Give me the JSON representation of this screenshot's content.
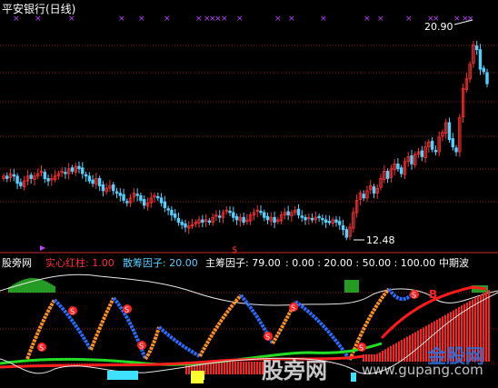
{
  "window": {
    "title": "平安银行(日线)"
  },
  "price_chart": {
    "high_label": "20.90",
    "low_label": "12.48",
    "gridline_color": "#8b1a1a",
    "up_color": "#ff3030",
    "down_color": "#54d0ff",
    "marker_color": "#c040ff"
  },
  "indicator_bar": {
    "source": "股旁网",
    "items": [
      {
        "label": "实心红柱",
        "value": "1.00",
        "color": "#ff3030"
      },
      {
        "label": "散筹因子",
        "value": "20.00",
        "color": "#54d0ff"
      },
      {
        "label": "主筹因子",
        "value": "79.00",
        "color": "#ffffff"
      }
    ],
    "levels": ": 0.00 : 20.00 : 50.00 : 100.00",
    "name": "中期波"
  },
  "watermarks": {
    "center": "股旁网",
    "url": "www.gupang.com",
    "brand": "金股网"
  },
  "chart_data": {
    "type": "candlestick",
    "title": "平安银行(日线)",
    "y_annotations": [
      {
        "label": "20.90",
        "value": 20.9
      },
      {
        "label": "12.48",
        "value": 12.48
      }
    ],
    "close": [
      15.0,
      14.9,
      15.1,
      15.0,
      14.7,
      14.6,
      14.8,
      15.0,
      14.9,
      15.0,
      15.1,
      15.2,
      14.9,
      14.8,
      14.9,
      15.0,
      15.1,
      15.2,
      15.1,
      15.3,
      15.2,
      15.4,
      15.3,
      15.1,
      15.0,
      14.8,
      14.7,
      14.9,
      14.6,
      14.4,
      14.5,
      14.6,
      14.4,
      14.3,
      14.2,
      14.0,
      13.9,
      14.1,
      14.3,
      14.2,
      14.0,
      13.8,
      13.9,
      14.1,
      14.2,
      14.1,
      13.9,
      13.7,
      13.6,
      13.4,
      13.3,
      13.1,
      13.0,
      12.9,
      12.95,
      13.0,
      13.1,
      13.2,
      13.1,
      13.2,
      13.1,
      13.3,
      13.4,
      13.3,
      13.5,
      13.6,
      13.5,
      13.3,
      13.2,
      13.3,
      13.1,
      13.2,
      13.4,
      13.5,
      13.6,
      13.5,
      13.3,
      13.2,
      13.3,
      13.1,
      13.2,
      13.4,
      13.5,
      13.4,
      13.5,
      13.6,
      13.4,
      13.3,
      13.2,
      13.3,
      13.2,
      13.3,
      13.3,
      13.2,
      13.1,
      13.1,
      13.2,
      13.1,
      13.0,
      12.8,
      12.48,
      12.9,
      13.5,
      14.0,
      14.3,
      14.1,
      14.4,
      14.6,
      14.3,
      14.5,
      14.9,
      15.2,
      14.9,
      15.3,
      15.5,
      15.3,
      15.1,
      15.6,
      15.8,
      15.5,
      15.9,
      16.0,
      15.8,
      16.2,
      16.4,
      16.1,
      16.0,
      16.6,
      16.8,
      17.2,
      16.5,
      16.2,
      16.0,
      17.4,
      18.6,
      19.0,
      19.6,
      20.4,
      20.2,
      19.4,
      19.3,
      18.8
    ]
  }
}
